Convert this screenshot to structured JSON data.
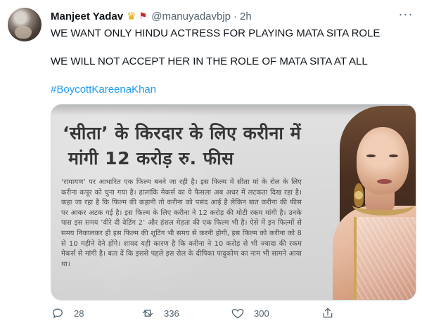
{
  "tweet": {
    "author": {
      "name": "Manjeet Yadav",
      "handle": "@manuyadavbjp",
      "time": "2h"
    },
    "text_lines": [
      "WE WANT ONLY HINDU ACTRESS FOR PLAYING MATA SITA ROLE",
      "WE WILL NOT ACCEPT HER IN THE ROLE OF MATA SITA AT ALL"
    ],
    "hashtag": "#BoycottKareenaKhan",
    "media": {
      "headline_line1": "‘सीता’ के किरदार के लिए करीना में",
      "headline_line2": "मांगी 12 करोड़ रु. फीस",
      "body": "‘रामायण’ पर आधारित एक फिल्म बनने जा रही है। इस फिल्म में सीता मां के रोल के लिए करीना कपूर को चुना गया है। हालांकि मेकर्स का ये फैसला अब अधर में लटकता दिख रहा है। कहा जा रहा है कि फिल्म की कहानी तो करीना को पसंद आई है लेकिन बात करीना की फीस पर आकर अटक गई है। इस फिल्म के लिए करीना ने 12 करोड़ की मोटी रकम मांगी है। उनके पास इस समय ‘वीरे दी वेडिंग 2’ और हंसल मेहता की एक फिल्म भी है। ऐसे में इन फिल्मों से समय निकालकर ही इस फिल्म की शूटिंग भी समय से करनी होगी, इस फिल्म को करीना को 8 से 10 महीने देने होंगे। शायद यही कारण है कि करीना ने 10 करोड़ से भी ज्यादा की रकम मेकर्स से मांगी है। बता दें कि इससे पहले इस रोल के दीपिका पादुकोण का नाम भी सामने आया था।"
    },
    "actions": {
      "replies": "28",
      "retweets": "336",
      "likes": "300"
    }
  },
  "icons": {
    "badge": "crown-icon",
    "flag": "flag-icon",
    "more": "more-icon",
    "reply": "reply-icon",
    "retweet": "retweet-icon",
    "like": "heart-icon",
    "share": "share-icon"
  },
  "colors": {
    "text": "#0f1419",
    "muted": "#536471",
    "link": "#1d9bf0",
    "border": "#cfd9de"
  }
}
